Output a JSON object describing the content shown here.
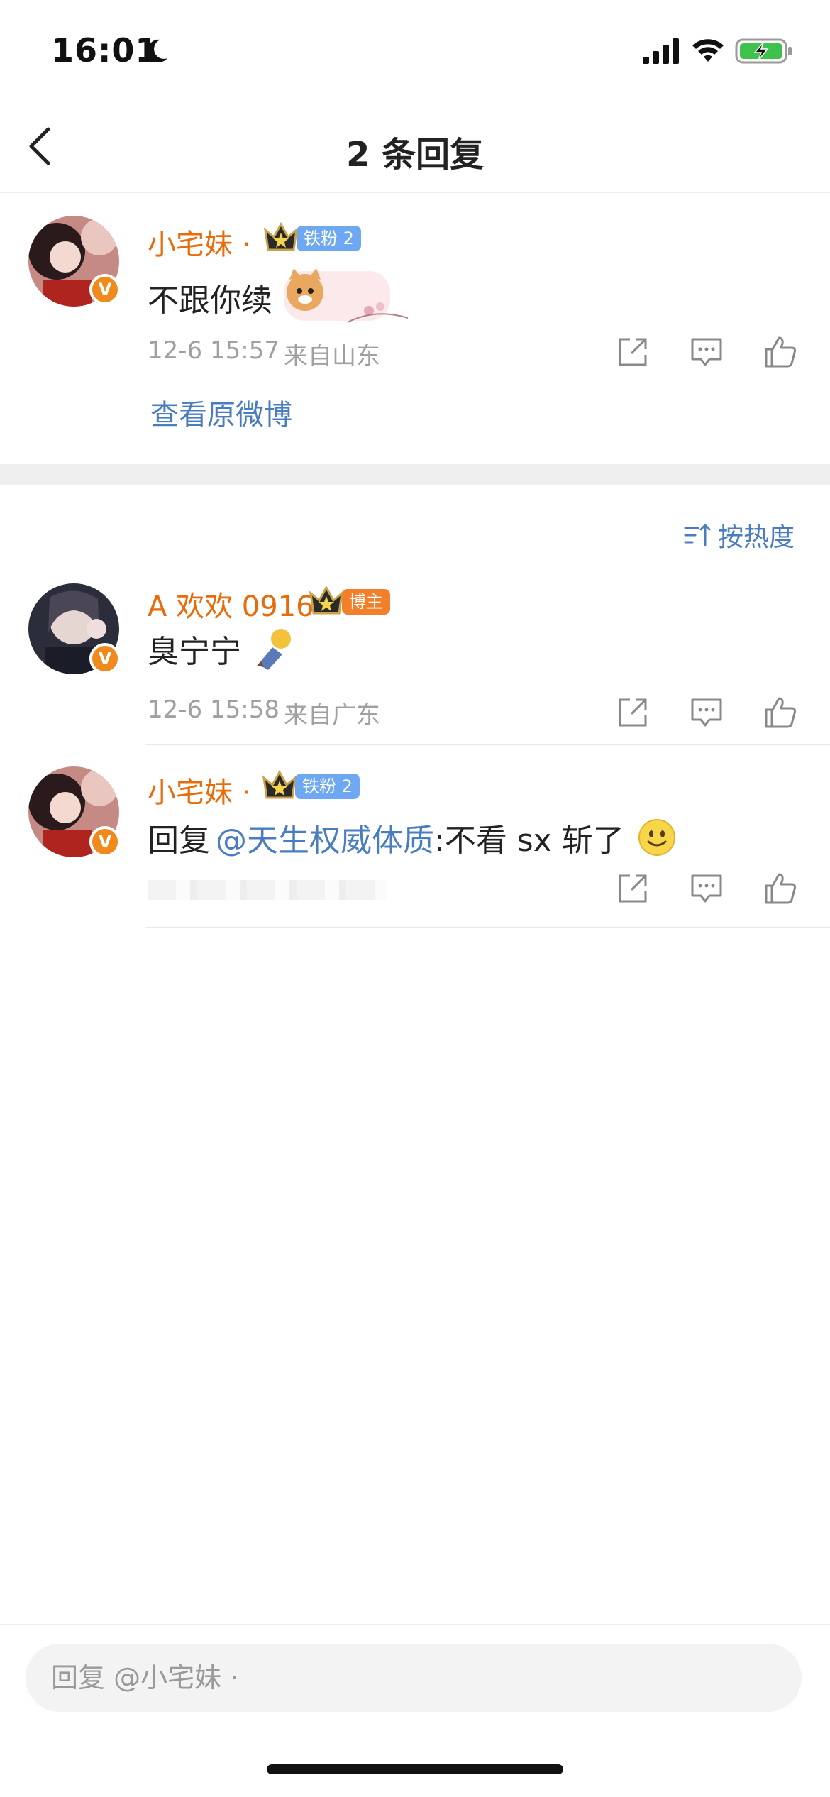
{
  "status": {
    "time": "16:01"
  },
  "nav": {
    "title": "2 条回复"
  },
  "main_comment": {
    "username": "小宅妹 ·",
    "fan_badge": "铁粉 2",
    "text": "不跟你续",
    "time": "12-6 15:57",
    "location": "来自山东",
    "view_original": "查看原微博"
  },
  "sort": {
    "label": "按热度"
  },
  "replies": [
    {
      "username": "A 欢欢 0916",
      "badge": "博主",
      "text": "臭宁宁",
      "time": "12-6 15:58",
      "location": "来自广东"
    },
    {
      "username": "小宅妹 ·",
      "fan_badge": "铁粉 2",
      "prefix": "回复",
      "mention": "@天生权威体质",
      "text": ":不看 sx 斩了"
    }
  ],
  "reply_bar": {
    "placeholder": "回复 @小宅妹 ·"
  },
  "colors": {
    "username": "#e86b0c",
    "link": "#4a7cc0",
    "meta": "#a0a0a0",
    "fan_badge": "#6fa8f2",
    "host_badge": "#f2802a"
  }
}
